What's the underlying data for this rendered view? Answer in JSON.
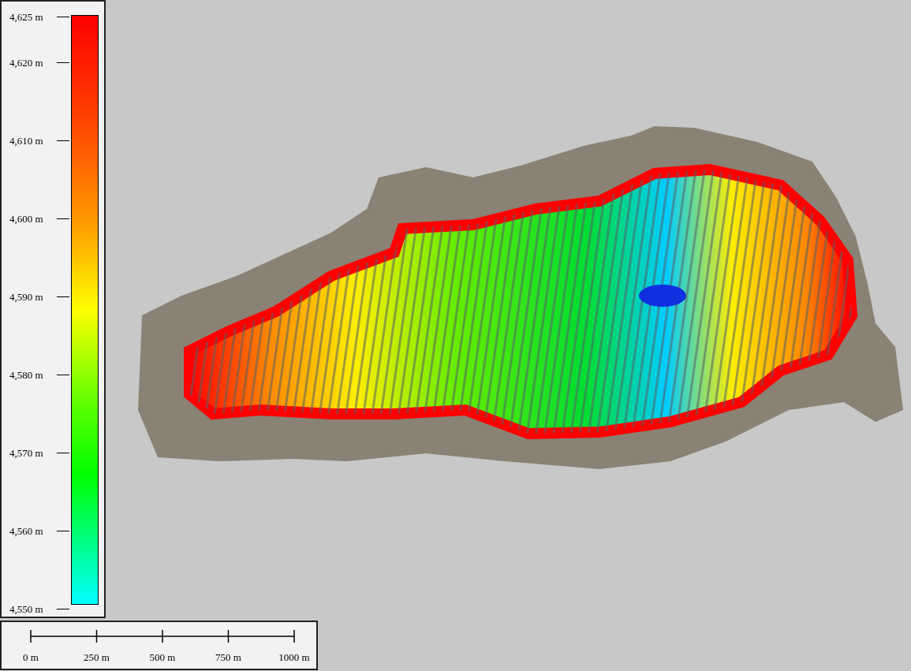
{
  "legend": {
    "labels": [
      "4,625 m",
      "4,620 m",
      "4,610 m",
      "4,600 m",
      "4,590 m",
      "4,580 m",
      "4,570 m",
      "4,560 m",
      "4,550 m"
    ]
  },
  "scale_bar": {
    "labels": [
      "0 m",
      "250 m",
      "500 m",
      "750 m",
      "1000 m"
    ]
  }
}
